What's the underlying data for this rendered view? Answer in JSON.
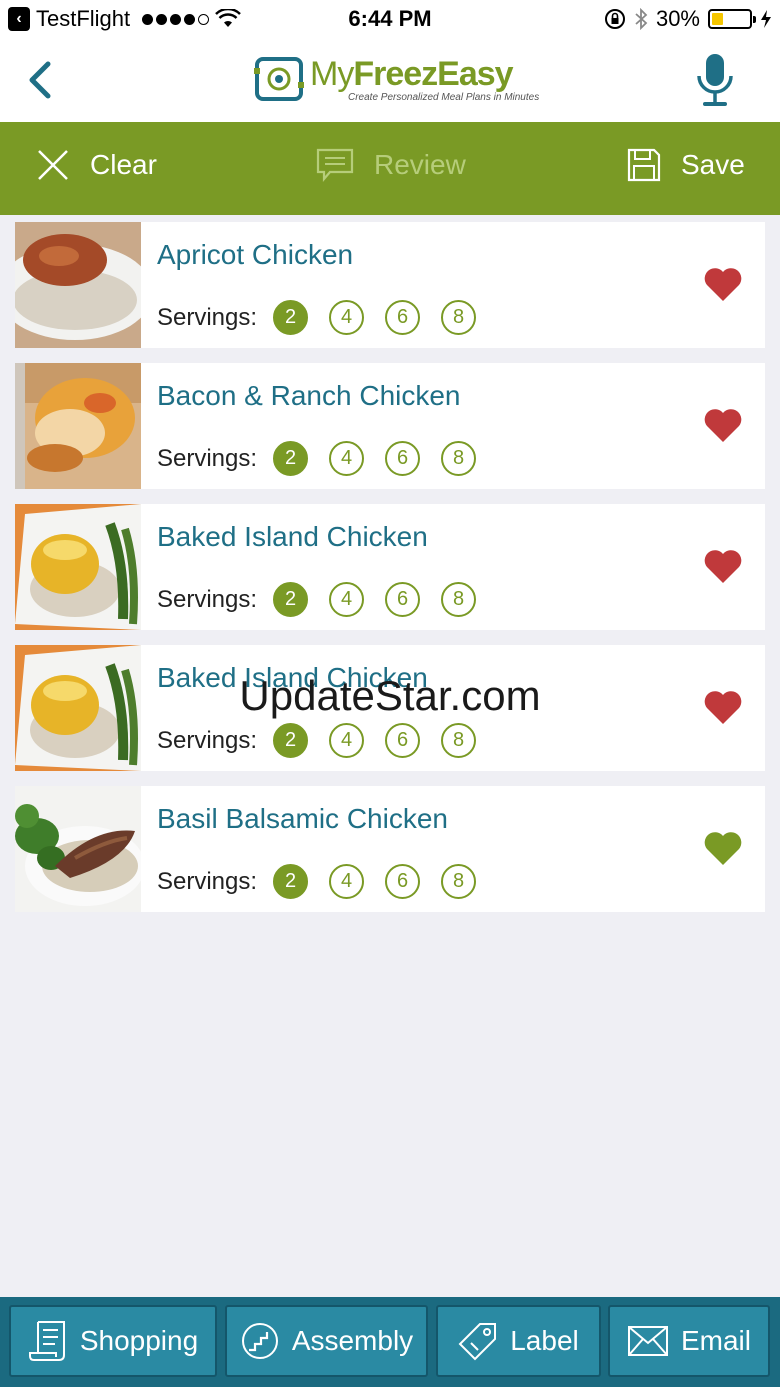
{
  "status_bar": {
    "back_app": "TestFlight",
    "time": "6:44 PM",
    "battery": "30%",
    "battery_level": 0.3
  },
  "header": {
    "logo_my": "My",
    "logo_freez": "FreezEasy",
    "logo_tagline": "Create Personalized Meal Plans in Minutes"
  },
  "toolbar": {
    "clear_label": "Clear",
    "review_label": "Review",
    "save_label": "Save"
  },
  "recipes": [
    {
      "title": "Apricot Chicken",
      "servings_label": "Servings:",
      "options": [
        "2",
        "4",
        "6",
        "8"
      ],
      "selected": "2",
      "heart_color": "#c0393b"
    },
    {
      "title": "Bacon & Ranch Chicken",
      "servings_label": "Servings:",
      "options": [
        "2",
        "4",
        "6",
        "8"
      ],
      "selected": "2",
      "heart_color": "#c0393b"
    },
    {
      "title": "Baked Island Chicken",
      "servings_label": "Servings:",
      "options": [
        "2",
        "4",
        "6",
        "8"
      ],
      "selected": "2",
      "heart_color": "#c0393b"
    },
    {
      "title": "Baked Island Chicken",
      "servings_label": "Servings:",
      "options": [
        "2",
        "4",
        "6",
        "8"
      ],
      "selected": "2",
      "heart_color": "#c0393b"
    },
    {
      "title": "Basil Balsamic Chicken",
      "servings_label": "Servings:",
      "options": [
        "2",
        "4",
        "6",
        "8"
      ],
      "selected": "2",
      "heart_color": "#7a9a25"
    }
  ],
  "watermark": "UpdateStar.com",
  "bottom_bar": {
    "shopping_label": "Shopping",
    "assembly_label": "Assembly",
    "label_label": "Label",
    "email_label": "Email"
  },
  "colors": {
    "brand_green": "#7a9a25",
    "title_blue": "#1f6f86",
    "bottom_teal": "#1b6a80"
  }
}
